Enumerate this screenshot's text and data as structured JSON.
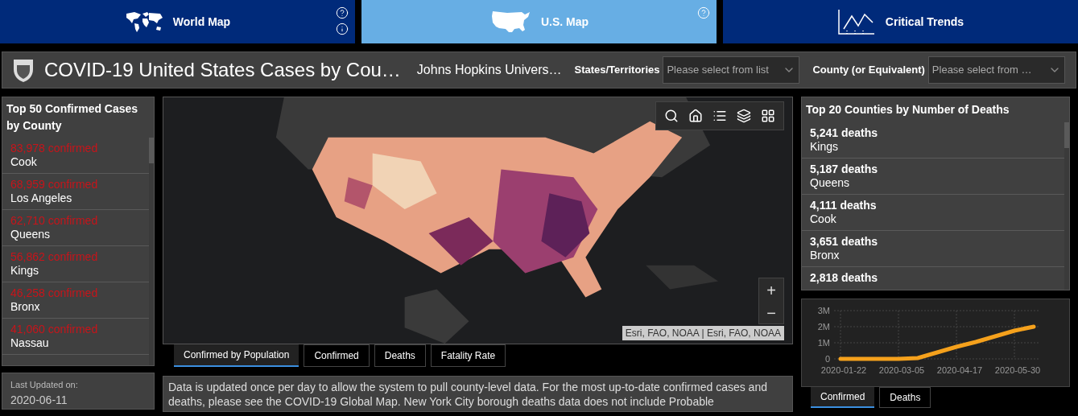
{
  "nav_tabs": [
    {
      "label": "World Map",
      "selected": false
    },
    {
      "label": "U.S. Map",
      "selected": true
    },
    {
      "label": "Critical Trends",
      "selected": false
    }
  ],
  "header": {
    "title": "COVID-19 United States Cases by Cou…",
    "source": "Johns Hopkins Univers…",
    "filters": [
      {
        "label": "States/Territories",
        "placeholder": "Please select from list"
      },
      {
        "label": "County (or Equivalent)",
        "placeholder": "Please select from …"
      }
    ]
  },
  "confirmed_panel": {
    "title": "Top 50 Confirmed Cases by County",
    "items": [
      {
        "count": "83,978 confirmed",
        "name": "Cook"
      },
      {
        "count": "68,959 confirmed",
        "name": "Los Angeles"
      },
      {
        "count": "62,710 confirmed",
        "name": "Queens"
      },
      {
        "count": "56,862 confirmed",
        "name": "Kings"
      },
      {
        "count": "46,258 confirmed",
        "name": "Bronx"
      },
      {
        "count": "41,060 confirmed",
        "name": "Nassau"
      }
    ]
  },
  "last_updated": {
    "label": "Last Updated on:",
    "value": "2020-06-11"
  },
  "map": {
    "kind": "picture",
    "zoom_in": "+",
    "zoom_out": "−",
    "attribution": "Esri, FAO, NOAA | Esri, FAO, NOAA"
  },
  "map_tabs": [
    {
      "label": "Confirmed by Population",
      "selected": true
    },
    {
      "label": "Confirmed",
      "selected": false
    },
    {
      "label": "Deaths",
      "selected": false
    },
    {
      "label": "Fatality Rate",
      "selected": false
    }
  ],
  "note": "Data is updated once per day to allow the system to pull county-level data. For the most up-to-date confirmed cases and deaths, please see the COVID-19 Global Map. New York City borough deaths data does not include Probable",
  "deaths_panel": {
    "title": "Top 20 Counties by Number of Deaths",
    "items": [
      {
        "count": "5,241 deaths",
        "name": "Kings"
      },
      {
        "count": "5,187 deaths",
        "name": "Queens"
      },
      {
        "count": "4,111 deaths",
        "name": "Cook"
      },
      {
        "count": "3,651 deaths",
        "name": "Bronx"
      },
      {
        "count": "2,818 deaths"
      }
    ]
  },
  "trend_chart": {
    "chart_data": {
      "type": "line",
      "categories": [
        "2020-01-22",
        null,
        null,
        "2020-03-05",
        null,
        null,
        "2020-04-17",
        null,
        null,
        "2020-05-30",
        null
      ],
      "series": [
        {
          "color": "#f5a11c",
          "values": [
            0,
            0,
            0,
            0,
            50000,
            400000,
            750000,
            1050000,
            1400000,
            1750000,
            2000000
          ]
        }
      ],
      "ylim": [
        0,
        3000000
      ],
      "yticks": [
        {
          "value": 0,
          "label": "0"
        },
        {
          "value": 1000000,
          "label": "1M"
        },
        {
          "value": 2000000,
          "label": "2M"
        },
        {
          "value": 3000000,
          "label": "3M"
        }
      ]
    }
  },
  "chart_tabs": [
    {
      "label": "Confirmed",
      "selected": true
    },
    {
      "label": "Deaths",
      "selected": false
    }
  ]
}
